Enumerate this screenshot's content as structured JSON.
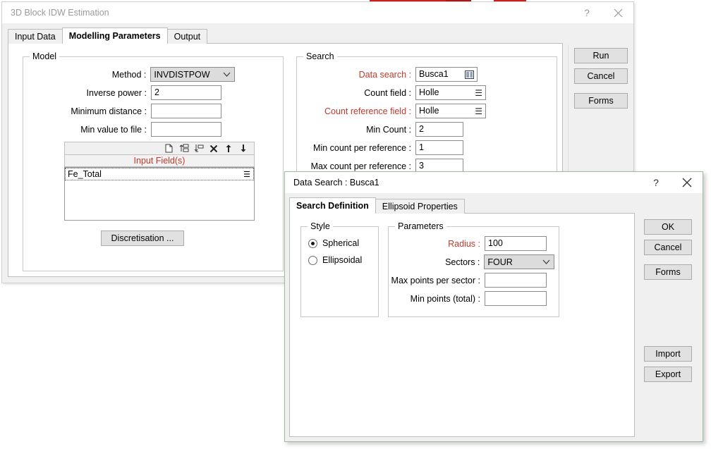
{
  "main_window": {
    "title": "3D Block IDW Estimation",
    "titlebar_buttons": [
      {
        "name": "help-button",
        "glyph": "?"
      },
      {
        "name": "close-button",
        "glyph": "✕"
      }
    ],
    "tabs": [
      {
        "label": "Input Data",
        "active": false
      },
      {
        "label": "Modelling Parameters",
        "active": true
      },
      {
        "label": "Output",
        "active": false
      }
    ],
    "side_buttons": [
      {
        "label": "Run"
      },
      {
        "label": "Cancel"
      },
      {
        "label": "Forms"
      }
    ],
    "model_group": {
      "title": "Model",
      "method": {
        "label": "Method :",
        "value": "INVDISTPOW",
        "type": "combo"
      },
      "inverse_power": {
        "label": "Inverse power :",
        "value": "2"
      },
      "minimum_distance": {
        "label": "Minimum distance :",
        "value": ""
      },
      "min_value_to_file": {
        "label": "Min value to file :",
        "value": ""
      },
      "field_list": {
        "header": "Input Field(s)",
        "toolbar_icons": [
          "new-file-icon",
          "insert-row-above-icon",
          "insert-row-below-icon",
          "delete-row-icon",
          "move-up-icon",
          "move-down-icon"
        ],
        "rows": [
          {
            "value": "Fe_Total",
            "icon": "list-picker-icon"
          }
        ]
      },
      "discretisation_button": "Discretisation ..."
    },
    "search_group": {
      "title": "Search",
      "fields": [
        {
          "label": "Data search :",
          "value": "Busca1",
          "required": true,
          "icon": "data-search-picker-icon",
          "width": 88
        },
        {
          "label": "Count field :",
          "value": "Holle",
          "required": false,
          "icon": "list-picker-icon",
          "width": 100
        },
        {
          "label": "Count reference field :",
          "value": "Holle",
          "required": true,
          "icon": "list-picker-icon",
          "width": 100
        },
        {
          "label": "Min Count :",
          "value": "2",
          "required": false,
          "icon": "",
          "width": 68
        },
        {
          "label": "Min count per reference :",
          "value": "1",
          "required": false,
          "icon": "",
          "width": 68
        },
        {
          "label": "Max count per reference :",
          "value": "3",
          "required": false,
          "icon": "",
          "width": 68
        }
      ]
    }
  },
  "data_search_dialog": {
    "title": "Data Search : Busca1",
    "titlebar_buttons": [
      {
        "name": "help-button",
        "glyph": "?"
      },
      {
        "name": "close-button",
        "glyph": "✕"
      }
    ],
    "tabs": [
      {
        "label": "Search Definition",
        "active": true
      },
      {
        "label": "Ellipsoid Properties",
        "active": false
      }
    ],
    "side_buttons_top": [
      {
        "label": "OK"
      },
      {
        "label": "Cancel"
      },
      {
        "label": "Forms"
      }
    ],
    "side_buttons_bottom": [
      {
        "label": "Import"
      },
      {
        "label": "Export"
      }
    ],
    "style_group": {
      "title": "Style",
      "options": [
        {
          "label": "Spherical",
          "checked": true
        },
        {
          "label": "Ellipsoidal",
          "checked": false
        }
      ]
    },
    "parameters_group": {
      "title": "Parameters",
      "radius": {
        "label": "Radius :",
        "value": "100",
        "required": true
      },
      "sectors": {
        "label": "Sectors :",
        "value": "FOUR",
        "type": "combo"
      },
      "max_points_per_sector": {
        "label": "Max  points per sector :",
        "value": ""
      },
      "min_points_total": {
        "label": "Min  points (total) :",
        "value": ""
      }
    }
  },
  "colors": {
    "required_label": "#c0392b",
    "active_window_border": "#9bbf9b",
    "background_strip": "#cc2020"
  }
}
